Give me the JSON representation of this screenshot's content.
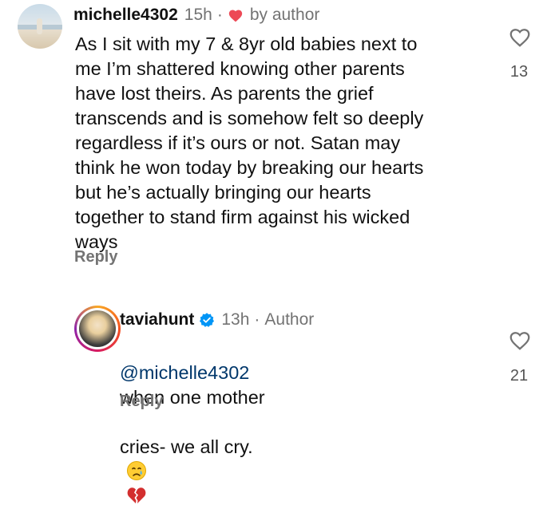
{
  "comments": [
    {
      "username": "michelle4302",
      "time": "15h",
      "separator": "·",
      "author_like_label": "by author",
      "text": "As I sit with my 7 & 8yr old babies next to\nme I’m shattered knowing other parents\nhave lost theirs. As parents the grief\ntranscends and is somehow felt so deeply\nregardless if it’s ours or not. Satan may\nthink he won today by breaking our hearts\nbut he’s actually bringing our hearts\ntogether to stand firm against his wicked\nways",
      "reply_label": "Reply",
      "like_count": "13"
    },
    {
      "username": "taviahunt",
      "time": "13h",
      "separator": "·",
      "author_label": "Author",
      "mention": "@michelle4302",
      "text_line1": "when one mother",
      "text_line2": "cries- we all cry.",
      "emojis": [
        "crying-face",
        "broken-heart"
      ],
      "reply_label": "Reply",
      "like_count": "21"
    }
  ],
  "colors": {
    "primary_text": "#111111",
    "secondary_text": "#737373",
    "mention": "#00376b",
    "author_heart": "#ed4956",
    "verified": "#0095f6"
  }
}
